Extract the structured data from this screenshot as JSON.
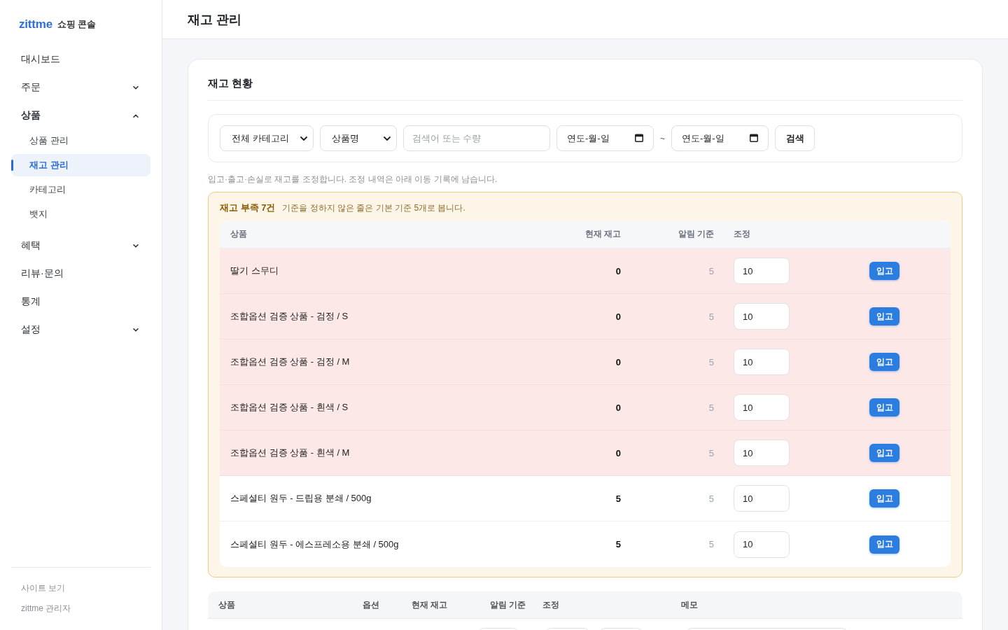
{
  "sidebar": {
    "logo": "zittme",
    "subtitle": "쇼핑 콘솔",
    "nav": [
      {
        "label": "대시보드",
        "kind": "link",
        "selected": false
      },
      {
        "label": "주문",
        "kind": "group",
        "expanded": false,
        "selected": false
      },
      {
        "label": "상품",
        "kind": "group",
        "expanded": true,
        "selected": false,
        "children": [
          {
            "label": "상품 관리",
            "selected": false
          },
          {
            "label": "재고 관리",
            "selected": true
          },
          {
            "label": "카테고리",
            "selected": false
          },
          {
            "label": "뱃지",
            "selected": false
          }
        ]
      },
      {
        "label": "혜택",
        "kind": "group",
        "expanded": false,
        "selected": false
      },
      {
        "label": "리뷰·문의",
        "kind": "link",
        "selected": false
      },
      {
        "label": "통계",
        "kind": "link",
        "selected": false
      },
      {
        "label": "설정",
        "kind": "group",
        "expanded": false,
        "selected": false
      }
    ],
    "footer_links": [
      "사이트 보기",
      "zittme 관리자"
    ]
  },
  "header": {
    "title": "재고 관리"
  },
  "card": {
    "title": "재고 현황",
    "filters": {
      "category_select": {
        "value": "전체 카테고리"
      },
      "field_select": {
        "value": "상품명"
      },
      "search": {
        "placeholder": "검색어 또는 수량"
      },
      "date_from": {
        "placeholder": "연도-월-일"
      },
      "separator": "~",
      "date_to": {
        "placeholder": "연도-월-일"
      },
      "search_button": "검색"
    },
    "hint": "입고·출고·손실로 재고를 조정합니다. 조정 내역은 아래 이동 기록에 남습니다.",
    "low_stock": {
      "title": "재고 부족 7건",
      "description": "기준을 정하지 않은 줄은 기본 기준 5개로 봅니다.",
      "columns": [
        "상품",
        "현재 재고",
        "알림 기준",
        "조정"
      ],
      "rows": [
        {
          "product": "딸기 스무디",
          "stock": "0",
          "threshold": "5",
          "quantity": "10",
          "action": "입고",
          "out_of_stock": true
        },
        {
          "product": "조합옵션 검증 상품 - 검정 / S",
          "stock": "0",
          "threshold": "5",
          "quantity": "10",
          "action": "입고",
          "out_of_stock": true
        },
        {
          "product": "조합옵션 검증 상품 - 검정 / M",
          "stock": "0",
          "threshold": "5",
          "quantity": "10",
          "action": "입고",
          "out_of_stock": true
        },
        {
          "product": "조합옵션 검증 상품 - 흰색 / S",
          "stock": "0",
          "threshold": "5",
          "quantity": "10",
          "action": "입고",
          "out_of_stock": true
        },
        {
          "product": "조합옵션 검증 상품 - 흰색 / M",
          "stock": "0",
          "threshold": "5",
          "quantity": "10",
          "action": "입고",
          "out_of_stock": true
        },
        {
          "product": "스페셜티 원두 - 드립용 분쇄 / 500g",
          "stock": "5",
          "threshold": "5",
          "quantity": "10",
          "action": "입고",
          "out_of_stock": false
        },
        {
          "product": "스페셜티 원두 - 에스프레소용 분쇄 / 500g",
          "stock": "5",
          "threshold": "5",
          "quantity": "10",
          "action": "입고",
          "out_of_stock": false
        }
      ]
    },
    "stock_table": {
      "columns": [
        "상품",
        "옵션",
        "현재 재고",
        "알림 기준",
        "조정",
        "메모"
      ]
    }
  }
}
